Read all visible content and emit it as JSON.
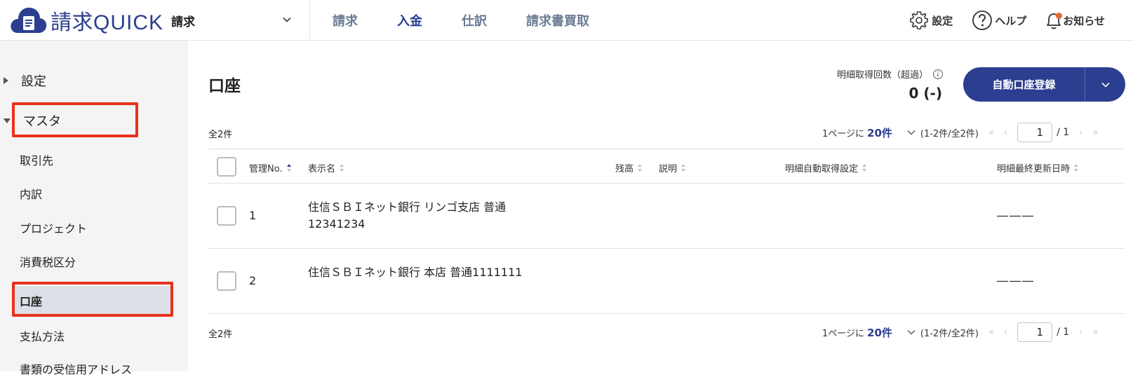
{
  "header": {
    "logo_text_jp": "請求",
    "logo_text_en": "QUICK",
    "app_selector": "請求",
    "nav": [
      {
        "label": "請求",
        "active": false
      },
      {
        "label": "入金",
        "active": true
      },
      {
        "label": "仕訳",
        "active": false
      },
      {
        "label": "請求書買取",
        "active": false
      }
    ],
    "settings_label": "設定",
    "help_label": "ヘルプ",
    "notifications_label": "お知らせ"
  },
  "sidebar": {
    "group_settings": "設定",
    "group_master": "マスタ",
    "items": [
      {
        "label": "取引先"
      },
      {
        "label": "内訳"
      },
      {
        "label": "プロジェクト"
      },
      {
        "label": "消費税区分"
      },
      {
        "label": "口座",
        "active": true
      },
      {
        "label": "支払方法"
      },
      {
        "label": "書類の受信用アドレス"
      }
    ]
  },
  "main": {
    "title": "口座",
    "quota_label": "明細取得回数（超過）",
    "quota_value": "0 (-)",
    "register_button": "自動口座登録",
    "total": "全2件",
    "pager": {
      "per_prefix": "1ページに",
      "per_value": "20件",
      "range": "(1-2件/全2件)",
      "first": "«",
      "prev": "‹",
      "page": "1",
      "of": "/ 1",
      "next": "›",
      "last": "»"
    },
    "columns": {
      "no": "管理No.",
      "name": "表示名",
      "balance": "残高",
      "description": "説明",
      "auto_fetch": "明細自動取得設定",
      "last_updated": "明細最終更新日時"
    },
    "rows": [
      {
        "no": "1",
        "name": "住信ＳＢＩネット銀行 リンゴ支店 普通12341234",
        "last_updated": "―――"
      },
      {
        "no": "2",
        "name": "住信ＳＢＩネット銀行 本店 普通1111111",
        "last_updated": "―――"
      }
    ]
  },
  "colors": {
    "brand": "#2b3e8f",
    "highlight_border": "#e8321c",
    "notification_dot": "#e26a2c",
    "sidebar_bg": "#f4f4f5"
  }
}
